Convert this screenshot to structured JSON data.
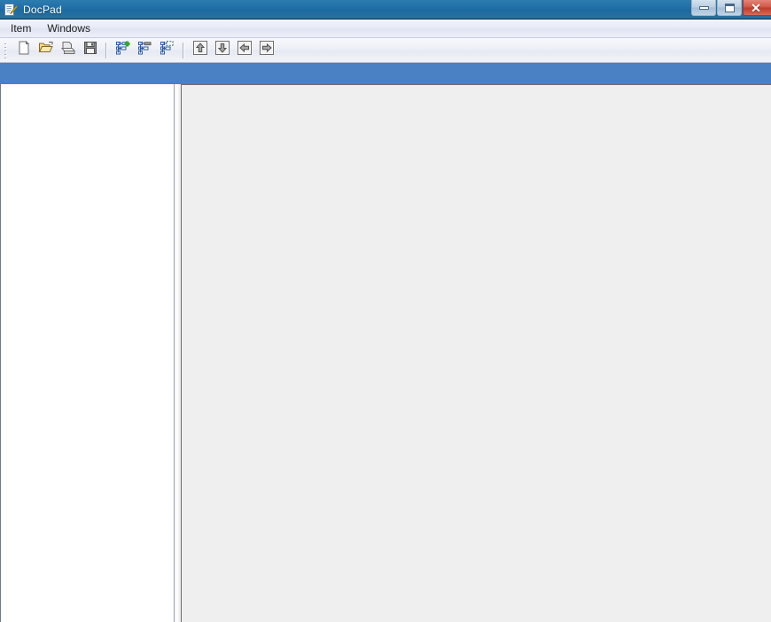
{
  "window": {
    "title": "DocPad",
    "icon": "docpad-document-pencil-icon",
    "controls": {
      "minimize_label": "Minimize",
      "maximize_label": "Maximize",
      "close_label": "Close"
    }
  },
  "menubar": {
    "items": [
      {
        "label": "Item",
        "name": "menu-item-item"
      },
      {
        "label": "Windows",
        "name": "menu-item-windows"
      }
    ]
  },
  "toolbar": {
    "groups": [
      {
        "buttons": [
          {
            "icon": "new-document-icon",
            "label": "New"
          },
          {
            "icon": "open-folder-icon",
            "label": "Open"
          },
          {
            "icon": "save-as-icon",
            "label": "Save As"
          },
          {
            "icon": "save-floppy-icon",
            "label": "Save"
          }
        ]
      },
      {
        "buttons": [
          {
            "icon": "add-tree-node-icon",
            "label": "Add Item"
          },
          {
            "icon": "edit-tree-node-icon",
            "label": "Edit Item"
          },
          {
            "icon": "delete-tree-node-icon",
            "label": "Remove Item"
          }
        ]
      },
      {
        "buttons": [
          {
            "icon": "arrow-up-icon",
            "label": "Move Up"
          },
          {
            "icon": "arrow-down-icon",
            "label": "Move Down"
          },
          {
            "icon": "arrow-left-icon",
            "label": "Move Left"
          },
          {
            "icon": "arrow-right-icon",
            "label": "Move Right"
          }
        ]
      }
    ]
  },
  "accent_band": {
    "color": "#4a80c4"
  },
  "panels": {
    "tree_panel": {
      "name": "document-tree-panel",
      "background": "#ffffff",
      "items": []
    },
    "content_panel": {
      "name": "document-content-panel",
      "background": "#efefef",
      "text": ""
    }
  }
}
